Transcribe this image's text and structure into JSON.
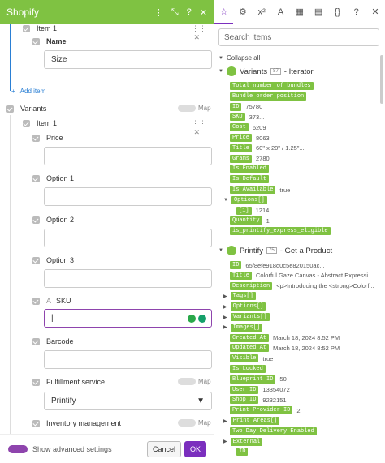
{
  "left": {
    "title": "Shopify",
    "header_icons": [
      "drag-icon",
      "expand-icon",
      "help-icon",
      "close-icon"
    ],
    "item1_top": "Item 1",
    "name_label": "Name",
    "name_value": "Size",
    "add_item": "Add item",
    "variants": "Variants",
    "map": "Map",
    "item1": "Item 1",
    "fields": [
      "Price",
      "Option 1",
      "Option 2",
      "Option 3"
    ],
    "sku": "SKU",
    "barcode": "Barcode",
    "fulfillment": "Fulfillment service",
    "fulfillment_value": "Printify",
    "inventory": "Inventory management",
    "show_advanced": "Show advanced settings",
    "cancel": "Cancel",
    "ok": "OK"
  },
  "right": {
    "search_placeholder": "Search items",
    "collapse_all": "Collapse all",
    "variants_module": {
      "name": "Variants",
      "num": "87",
      "sub": "- Iterator"
    },
    "variants_items": [
      {
        "k": "Total number of bundles",
        "v": ""
      },
      {
        "k": "Bundle order position",
        "v": ""
      },
      {
        "k": "ID",
        "v": "75780"
      },
      {
        "k": "SKU",
        "v": "373..."
      },
      {
        "k": "Cost",
        "v": "6209"
      },
      {
        "k": "Price",
        "v": "8063"
      },
      {
        "k": "Title",
        "v": "60\" x 20\" / 1.25\"..."
      },
      {
        "k": "Grams",
        "v": "2780"
      },
      {
        "k": "Is Enabled",
        "v": ""
      },
      {
        "k": "Is Default",
        "v": ""
      },
      {
        "k": "Is Available",
        "v": "true"
      },
      {
        "k": "Options[]",
        "v": ""
      },
      {
        "k": "[1]",
        "v": "1214"
      },
      {
        "k": "Quantity",
        "v": "1"
      },
      {
        "k": "is_printify_express_eligible",
        "v": ""
      }
    ],
    "printify_module": {
      "name": "Printify",
      "num": "75",
      "sub": "- Get a Product"
    },
    "printify_items": [
      {
        "k": "ID",
        "v": "65f8efe918d0c5e820150ac..."
      },
      {
        "k": "Title",
        "v": "Colorful Gaze Canvas - Abstract Expressi..."
      },
      {
        "k": "Description",
        "v": "<p>Introducing the <strong>Colorf..."
      },
      {
        "k": "Tags[]",
        "v": ""
      },
      {
        "k": "Options[]",
        "v": ""
      },
      {
        "k": "Variants[]",
        "v": ""
      },
      {
        "k": "Images[]",
        "v": ""
      },
      {
        "k": "Created At",
        "v": "March 18, 2024 8:52 PM"
      },
      {
        "k": "Updated At",
        "v": "March 18, 2024 8:52 PM"
      },
      {
        "k": "Visible",
        "v": "true"
      },
      {
        "k": "Is Locked",
        "v": ""
      },
      {
        "k": "Blueprint ID",
        "v": "50"
      },
      {
        "k": "User ID",
        "v": "13354072"
      },
      {
        "k": "Shop ID",
        "v": "9232151"
      },
      {
        "k": "Print Provider ID",
        "v": "2"
      },
      {
        "k": "Print Areas[]",
        "v": ""
      },
      {
        "k": "Two Day Delivery Enabled",
        "v": ""
      },
      {
        "k": "External",
        "v": ""
      },
      {
        "k": "ID",
        "v": ""
      }
    ]
  }
}
